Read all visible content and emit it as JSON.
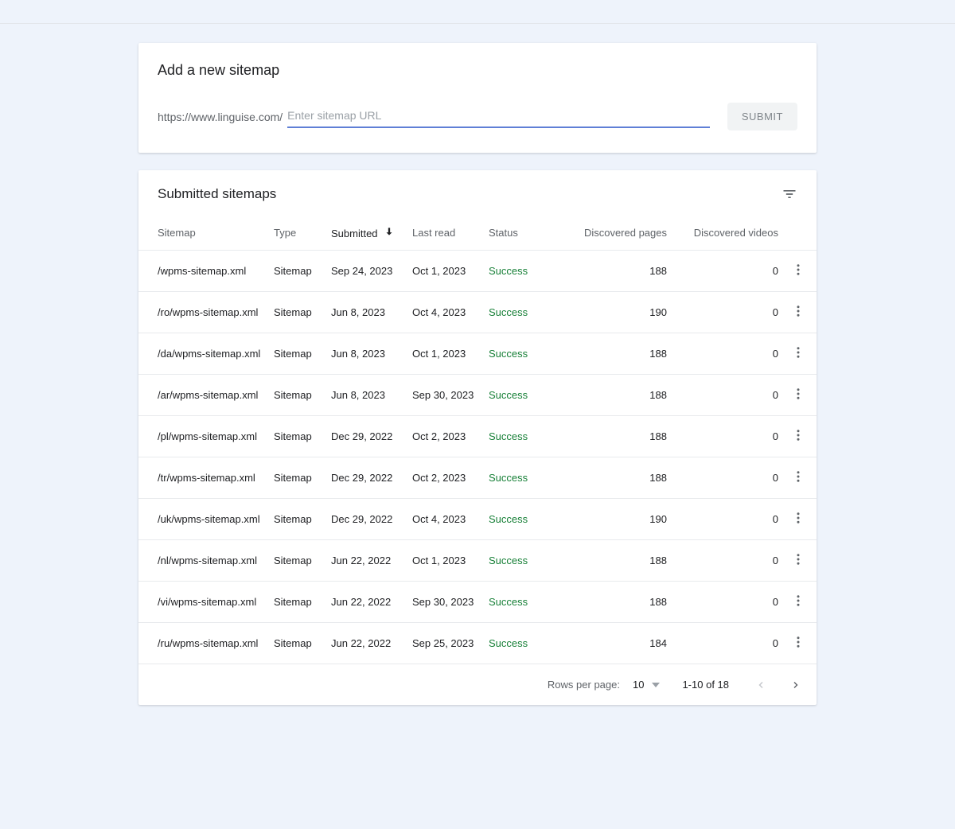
{
  "add_sitemap": {
    "title": "Add a new sitemap",
    "prefix": "https://www.linguise.com/",
    "placeholder": "Enter sitemap URL",
    "submit_label": "SUBMIT"
  },
  "submitted": {
    "title": "Submitted sitemaps",
    "columns": {
      "sitemap": "Sitemap",
      "type": "Type",
      "submitted": "Submitted",
      "last_read": "Last read",
      "status": "Status",
      "discovered_pages": "Discovered pages",
      "discovered_videos": "Discovered videos"
    },
    "rows": [
      {
        "sitemap": "/wpms-sitemap.xml",
        "type": "Sitemap",
        "submitted": "Sep 24, 2023",
        "last_read": "Oct 1, 2023",
        "status": "Success",
        "pages": "188",
        "videos": "0"
      },
      {
        "sitemap": "/ro/wpms-sitemap.xml",
        "type": "Sitemap",
        "submitted": "Jun 8, 2023",
        "last_read": "Oct 4, 2023",
        "status": "Success",
        "pages": "190",
        "videos": "0"
      },
      {
        "sitemap": "/da/wpms-sitemap.xml",
        "type": "Sitemap",
        "submitted": "Jun 8, 2023",
        "last_read": "Oct 1, 2023",
        "status": "Success",
        "pages": "188",
        "videos": "0"
      },
      {
        "sitemap": "/ar/wpms-sitemap.xml",
        "type": "Sitemap",
        "submitted": "Jun 8, 2023",
        "last_read": "Sep 30, 2023",
        "status": "Success",
        "pages": "188",
        "videos": "0"
      },
      {
        "sitemap": "/pl/wpms-sitemap.xml",
        "type": "Sitemap",
        "submitted": "Dec 29, 2022",
        "last_read": "Oct 2, 2023",
        "status": "Success",
        "pages": "188",
        "videos": "0"
      },
      {
        "sitemap": "/tr/wpms-sitemap.xml",
        "type": "Sitemap",
        "submitted": "Dec 29, 2022",
        "last_read": "Oct 2, 2023",
        "status": "Success",
        "pages": "188",
        "videos": "0"
      },
      {
        "sitemap": "/uk/wpms-sitemap.xml",
        "type": "Sitemap",
        "submitted": "Dec 29, 2022",
        "last_read": "Oct 4, 2023",
        "status": "Success",
        "pages": "190",
        "videos": "0"
      },
      {
        "sitemap": "/nl/wpms-sitemap.xml",
        "type": "Sitemap",
        "submitted": "Jun 22, 2022",
        "last_read": "Oct 1, 2023",
        "status": "Success",
        "pages": "188",
        "videos": "0"
      },
      {
        "sitemap": "/vi/wpms-sitemap.xml",
        "type": "Sitemap",
        "submitted": "Jun 22, 2022",
        "last_read": "Sep 30, 2023",
        "status": "Success",
        "pages": "188",
        "videos": "0"
      },
      {
        "sitemap": "/ru/wpms-sitemap.xml",
        "type": "Sitemap",
        "submitted": "Jun 22, 2022",
        "last_read": "Sep 25, 2023",
        "status": "Success",
        "pages": "184",
        "videos": "0"
      }
    ],
    "footer": {
      "rows_per_page_label": "Rows per page:",
      "rows_per_page_value": "10",
      "range": "1-10 of 18"
    }
  }
}
